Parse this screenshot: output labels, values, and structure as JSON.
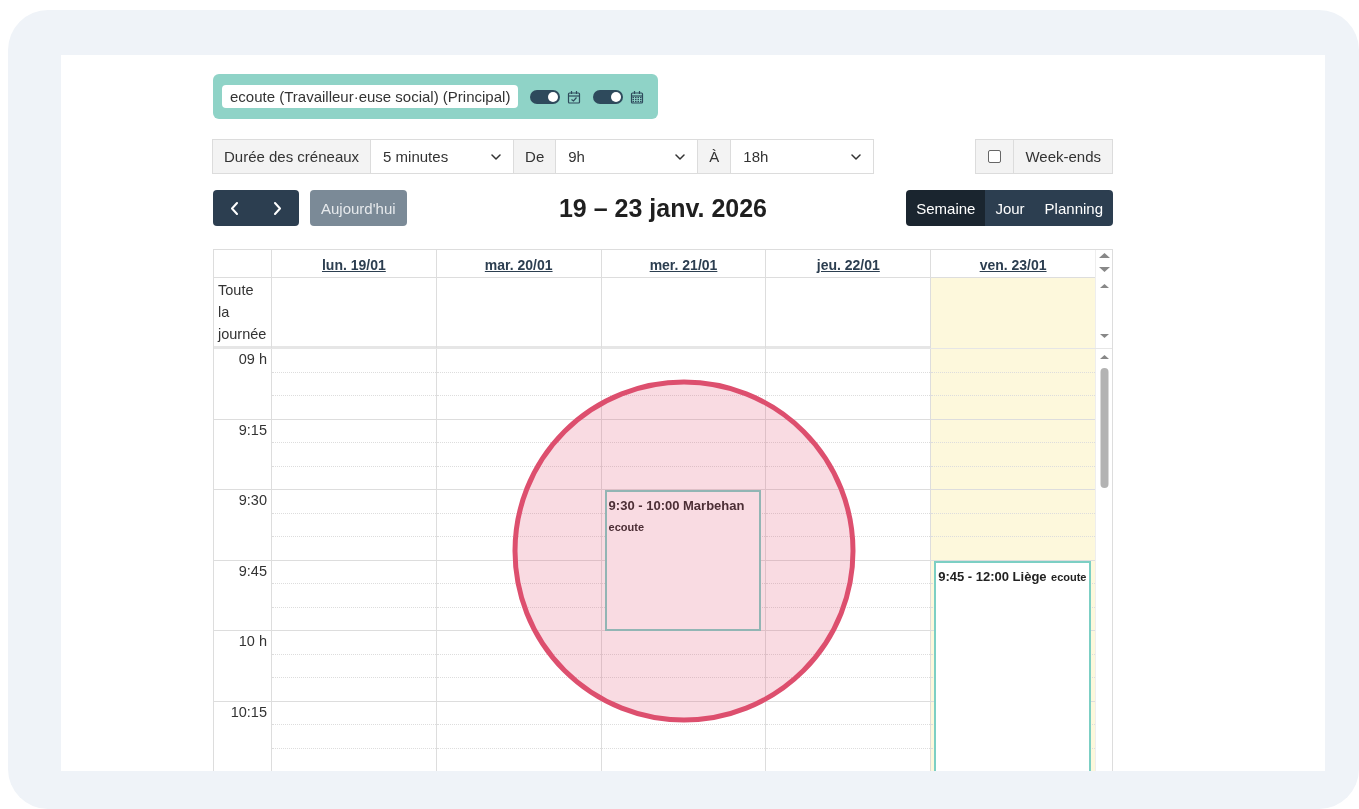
{
  "calendar_tag": {
    "label": "ecoute (Travailleur·euse social) (Principal)",
    "toggles": [
      {
        "on": true,
        "kind": "check"
      },
      {
        "on": true,
        "kind": "grid"
      }
    ]
  },
  "filters": {
    "slot_duration": {
      "label": "Durée des créneaux",
      "value": "5 minutes"
    },
    "from": {
      "label": "De",
      "value": "9h"
    },
    "to": {
      "label": "À",
      "value": "18h"
    },
    "weekends": {
      "label": "Week-ends",
      "checked": false
    }
  },
  "nav": {
    "today": {
      "label": "Aujourd'hui",
      "disabled": true
    },
    "title": "19 – 23 janv. 2026",
    "views": [
      {
        "label": "Semaine",
        "selected": true
      },
      {
        "label": "Jour",
        "selected": false
      },
      {
        "label": "Planning",
        "selected": false
      }
    ]
  },
  "all_day_label": "Toute la journée",
  "time_labels": [
    "09 h",
    "9:15",
    "9:30",
    "9:45",
    "10 h",
    "10:15"
  ],
  "days": [
    {
      "label": "lun. 19/01",
      "today": false
    },
    {
      "label": "mar. 20/01",
      "today": false
    },
    {
      "label": "mer. 21/01",
      "today": false,
      "events": [
        {
          "title": "9:30 - 10:00 Marbehan",
          "calendar": "ecoute"
        }
      ]
    },
    {
      "label": "jeu. 22/01",
      "today": false
    },
    {
      "label": "ven. 23/01",
      "today": true,
      "events": [
        {
          "title": "9:45 - 12:00 Liège",
          "calendar": "ecoute"
        }
      ]
    }
  ],
  "annotation": {
    "kind": "circle"
  }
}
